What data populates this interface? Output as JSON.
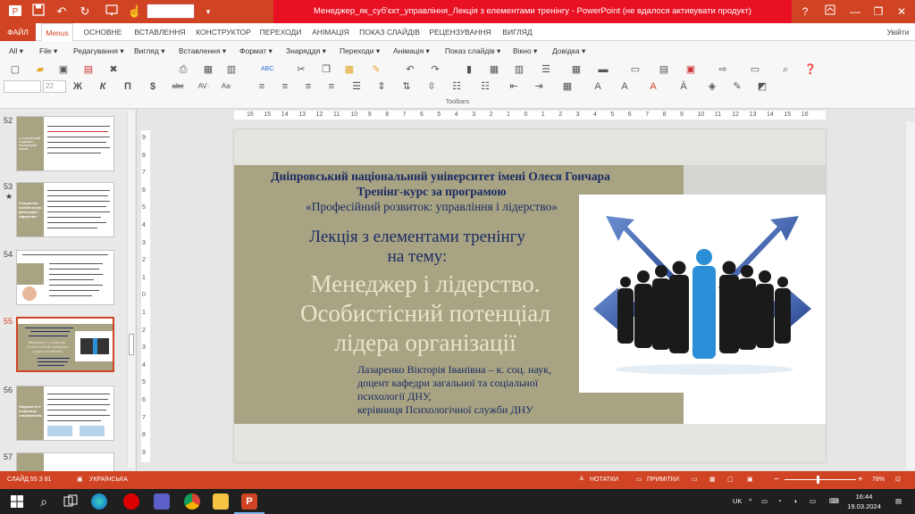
{
  "quick_access": {
    "save_icon": "save-icon",
    "undo_icon": "undo-icon",
    "redo_icon": "redo-icon",
    "start_icon": "start-slideshow-icon",
    "touch_icon": "touch-mode-icon"
  },
  "window": {
    "title": "Менеджер_як_суб'єкт_управління_Лекція з елементами тренінгу  -  PowerPoint (не вдалося активувати продукт)",
    "help_label": "?",
    "min_label": "—",
    "max_label": "❐",
    "close_label": "✕"
  },
  "tabs": [
    {
      "label": "ФАЙЛ"
    },
    {
      "label": "Menus"
    },
    {
      "label": "ОСНОВНЕ"
    },
    {
      "label": "ВСТАВЛЕННЯ"
    },
    {
      "label": "КОНСТРУКТОР"
    },
    {
      "label": "ПЕРЕХОДИ"
    },
    {
      "label": "АНІМАЦІЯ"
    },
    {
      "label": "ПОКАЗ СЛАЙДІВ"
    },
    {
      "label": "РЕЦЕНЗУВАННЯ"
    },
    {
      "label": "ВИГЛЯД"
    }
  ],
  "user_label": "Увійти",
  "menus": [
    {
      "label": "All ▾"
    },
    {
      "label": "File ▾"
    },
    {
      "label": "Редагування ▾"
    },
    {
      "label": "Вигляд ▾"
    },
    {
      "label": "Вставлення ▾"
    },
    {
      "label": "Формат ▾"
    },
    {
      "label": "Знаряддя ▾"
    },
    {
      "label": "Переходи ▾"
    },
    {
      "label": "Анімація ▾"
    },
    {
      "label": "Показ слайдів ▾"
    },
    {
      "label": "Вікно ▾"
    },
    {
      "label": "Довідка ▾"
    }
  ],
  "font_size_value": "22",
  "format_buttons": [
    {
      "label": "Ж"
    },
    {
      "label": "К"
    },
    {
      "label": "П"
    },
    {
      "label": "$"
    },
    {
      "label": "abc"
    },
    {
      "label": "AV·"
    },
    {
      "label": "Aa·"
    }
  ],
  "ribbon_label": "Toolbars",
  "slides_panel": [
    {
      "number": "52"
    },
    {
      "number": "53"
    },
    {
      "number": "54"
    },
    {
      "number": "55"
    },
    {
      "number": "56"
    },
    {
      "number": "57"
    }
  ],
  "slide53_marker": "★",
  "thumb_labels": {
    "s52": "у Стратегічний соціально-економічний аналіз",
    "s53": "Створення особистісної філософії і лідерства",
    "s55_big": "Менеджер і лідерство. Особистісний потенціал лідера організації",
    "s56": "Людина та її соціальне становлення"
  },
  "ruler": {
    "h_ticks": [
      "16",
      "15",
      "14",
      "13",
      "12",
      "11",
      "10",
      "9",
      "8",
      "7",
      "6",
      "5",
      "4",
      "3",
      "2",
      "1",
      "0",
      "1",
      "2",
      "3",
      "4",
      "5",
      "6",
      "7",
      "8",
      "9",
      "10",
      "11",
      "12",
      "13",
      "14",
      "15",
      "16"
    ],
    "v_ticks": [
      "9",
      "8",
      "7",
      "6",
      "5",
      "4",
      "3",
      "2",
      "1",
      "0",
      "1",
      "2",
      "3",
      "4",
      "5",
      "6",
      "7",
      "8",
      "9"
    ]
  },
  "slide": {
    "university": "Дніпровський національний університет імені Олеся Гончара",
    "course": "Тренінг-курс за програмою",
    "program": "«Професійний розвиток: управління і лідерство»",
    "lecture_line1": "Лекція з елементами тренінгу",
    "lecture_line2": "на тему:",
    "topic_line1": "Менеджер і лідерство.",
    "topic_line2": "Особистісний потенціал",
    "topic_line3": "лідера організації",
    "author_line1": "Лазаренко Вікторія Іванівна – к. соц. наук,",
    "author_line2": "доцент кафедри загальної та соціальної",
    "author_line3": "психології ДНУ,",
    "author_line4": "керівниця Психологічної служби ДНУ"
  },
  "status": {
    "slide_info": "СЛАЙД 55 З 81",
    "language": "УКРАЇНСЬКА",
    "notes_label": "НОТАТКИ",
    "comments_label": "ПРИМІТКИ",
    "zoom_minus": "−",
    "zoom_plus": "+",
    "zoom": "78%"
  },
  "taskbar": {
    "lang": "UK",
    "time": "16:44",
    "date": "19.03.2024"
  },
  "colors": {
    "accent": "#d04423",
    "slide_olive": "#a7a383",
    "slide_title_blue": "#1c2b63",
    "topic_text": "#eae6c8",
    "figure_blue": "#2a8fd6"
  }
}
